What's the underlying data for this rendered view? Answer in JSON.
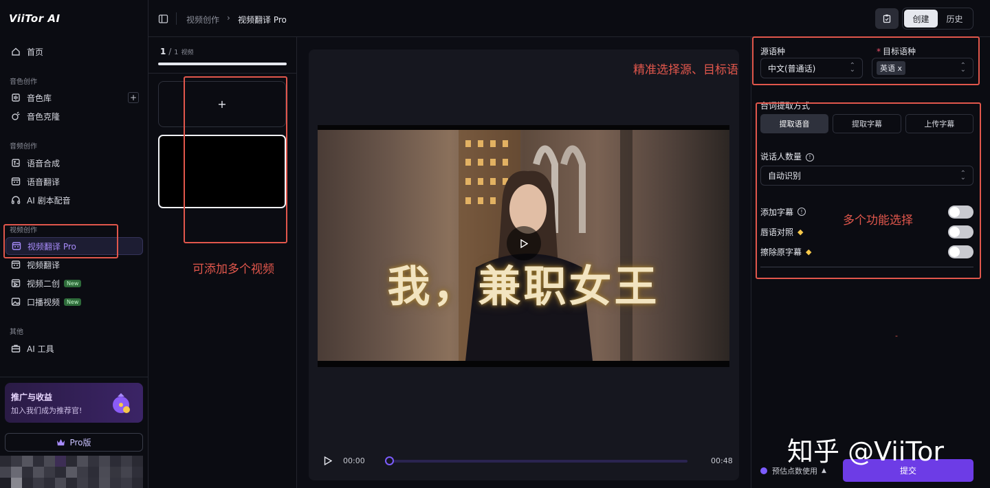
{
  "app": {
    "logo_text": "ViiTor AI"
  },
  "sidebar": {
    "home": "首页",
    "sections": [
      {
        "label": "音色创作",
        "items": [
          {
            "label": "音色库",
            "icon": "voice-library-icon"
          },
          {
            "label": "音色克隆",
            "icon": "voice-clone-icon"
          }
        ]
      },
      {
        "label": "音频创作",
        "items": [
          {
            "label": "语音合成",
            "icon": "speech-synthesis-icon"
          },
          {
            "label": "语音翻译",
            "icon": "voice-translate-icon"
          },
          {
            "label": "AI 剧本配音",
            "icon": "headphones-icon"
          }
        ]
      },
      {
        "label": "视频创作",
        "items": [
          {
            "label": "视频翻译 Pro",
            "icon": "video-translate-icon",
            "active": true
          },
          {
            "label": "视频翻译",
            "icon": "video-translate-icon"
          },
          {
            "label": "视频二创",
            "icon": "video-remix-icon",
            "badge": "New"
          },
          {
            "label": "口播视频",
            "icon": "image-icon",
            "badge": "New"
          }
        ]
      },
      {
        "label": "其他",
        "items": [
          {
            "label": "AI 工具",
            "icon": "toolbox-icon"
          }
        ]
      }
    ],
    "promo": {
      "title": "推广与收益",
      "subtitle": "加入我们成为推荐官!"
    },
    "pro_button": "Pro版"
  },
  "header": {
    "breadcrumb": [
      "视频创作",
      "视频翻译 Pro"
    ],
    "tabs": [
      "创建",
      "历史"
    ],
    "active_tab": "创建"
  },
  "video_list": {
    "current": "1",
    "total": "1",
    "unit": "视频",
    "add_symbol": "+"
  },
  "player": {
    "caption": "我，兼职女王",
    "time_current": "00:00",
    "time_total": "00:48",
    "progress": 0
  },
  "settings": {
    "source_label": "源语种",
    "source_value": "中文(普通话)",
    "target_label": "目标语种",
    "target_tag": "英语",
    "target_tag_remove": "x",
    "extract_label": "台词提取方式",
    "extract_options": [
      "提取语音",
      "提取字幕",
      "上传字幕"
    ],
    "extract_selected": "提取语音",
    "speakers_label": "说话人数量",
    "speakers_value": "自动识别",
    "toggles": [
      {
        "label": "添加字幕",
        "info": true,
        "premium": false,
        "on": false
      },
      {
        "label": "唇语对照",
        "info": false,
        "premium": true,
        "on": false
      },
      {
        "label": "擦除原字幕",
        "info": false,
        "premium": true,
        "on": false
      }
    ],
    "estimate_label": "预估点数使用",
    "submit_label": "提交",
    "dash": "-"
  },
  "annotations": {
    "language": "精准选择源、目标语",
    "multi_video": "可添加多个视频",
    "features": "多个功能选择"
  },
  "watermark": "知乎 @ViiTor",
  "colors": {
    "accent": "#7c5cff",
    "submit": "#6d3ce6",
    "annotation": "#e2574c",
    "active_nav": "#a78bfa"
  }
}
